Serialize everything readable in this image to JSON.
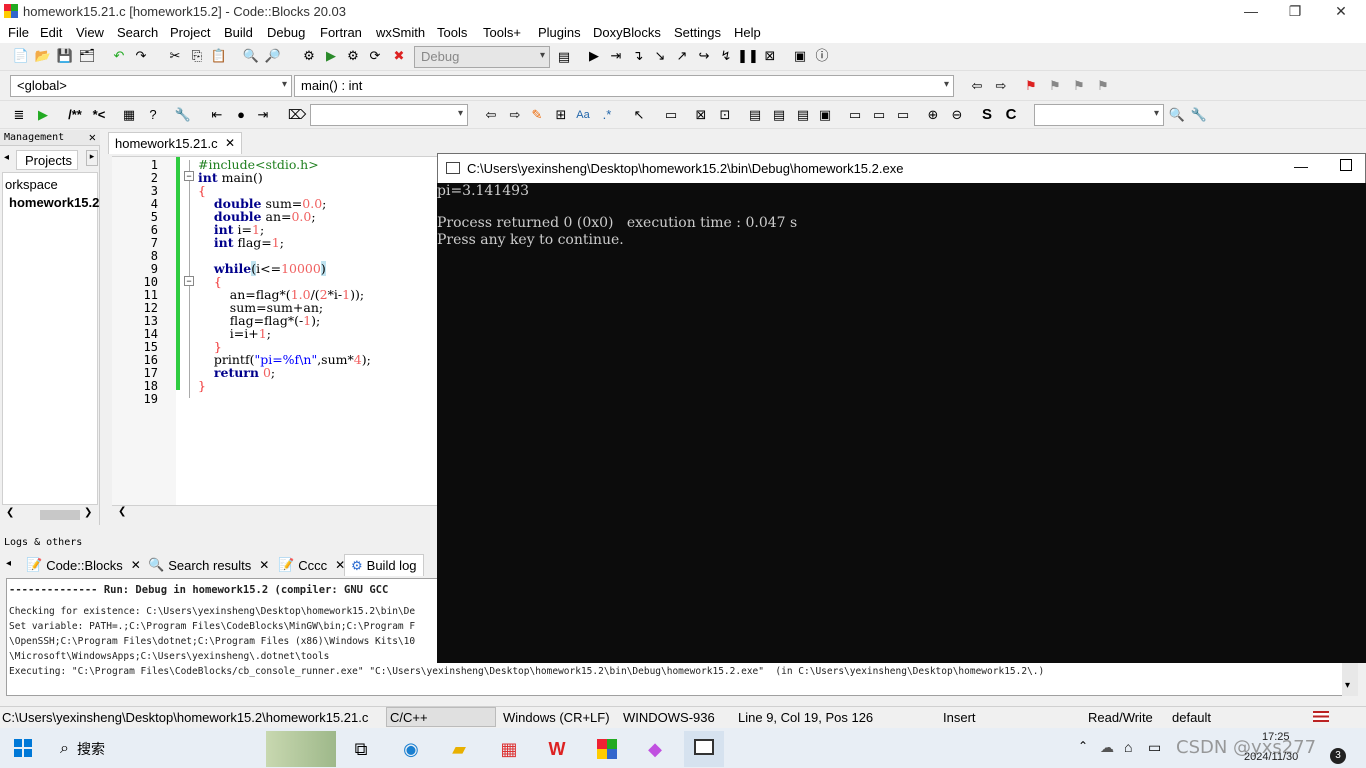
{
  "window": {
    "title": "homework15.21.c [homework15.2] - Code::Blocks 20.03",
    "controls": [
      "—",
      "❐",
      "✕"
    ]
  },
  "menubar": {
    "items": [
      "File",
      "Edit",
      "View",
      "Search",
      "Project",
      "Build",
      "Debug",
      "Fortran",
      "wxSmith",
      "Tools",
      "Tools+",
      "Plugins",
      "DoxyBlocks",
      "Settings",
      "Help"
    ]
  },
  "toolbar": {
    "build_target": "Debug",
    "scope": "<global>",
    "function": "main() : int"
  },
  "management": {
    "header": "Management",
    "tab_label": "Projects",
    "tree": [
      "orkspace",
      "homework15.2"
    ]
  },
  "editor": {
    "tab_label": "homework15.21.c",
    "line_numbers": [
      "1",
      "2",
      "3",
      "4",
      "5",
      "6",
      "7",
      "8",
      "9",
      "10",
      "11",
      "12",
      "13",
      "14",
      "15",
      "16",
      "17",
      "18",
      "19"
    ]
  },
  "console": {
    "title": "C:\\Users\\yexinsheng\\Desktop\\homework15.2\\bin\\Debug\\homework15.2.exe",
    "lines": [
      "pi=3.141493",
      "",
      "Process returned 0 (0x0)   execution time : 0.047 s",
      "Press any key to continue."
    ]
  },
  "logs": {
    "header": "Logs & others",
    "tabs": [
      "Code::Blocks",
      "Search results",
      "Cccc",
      "Build log"
    ],
    "lines": [
      "-------------- Run: Debug in homework15.2 (compiler: GNU GCC",
      "Checking for existence: C:\\Users\\yexinsheng\\Desktop\\homework15.2\\bin\\De",
      "Set variable: PATH=.;C:\\Program Files\\CodeBlocks\\MinGW\\bin;C:\\Program F",
      "\\OpenSSH;C:\\Program Files\\dotnet;C:\\Program Files (x86)\\Windows Kits\\10",
      "\\Microsoft\\WindowsApps;C:\\Users\\yexinsheng\\.dotnet\\tools",
      "Executing: \"C:\\Program Files\\CodeBlocks/cb_console_runner.exe\" \"C:\\Users\\yexinsheng\\Desktop\\homework15.2\\bin\\Debug\\homework15.2.exe\"  (in C:\\Users\\yexinsheng\\Desktop\\homework15.2\\.)"
    ]
  },
  "statusbar": {
    "path": "C:\\Users\\yexinsheng\\Desktop\\homework15.2\\homework15.21.c",
    "language": "C/C++",
    "line_endings": "Windows (CR+LF)",
    "encoding": "WINDOWS-936",
    "position": "Line 9, Col 19, Pos 126",
    "mode": "Insert",
    "access": "Read/Write",
    "theme": "default"
  },
  "taskbar": {
    "search_label": "搜索",
    "time": "17:25",
    "date": "2024/11/30",
    "watermark": "CSDN @yxs277",
    "notification_count": "3"
  },
  "colors": {
    "accent": "#0078d7",
    "keyword": "#00008b",
    "number": "#f06060",
    "string": "#0000ff",
    "preprocessor": "#208020"
  }
}
